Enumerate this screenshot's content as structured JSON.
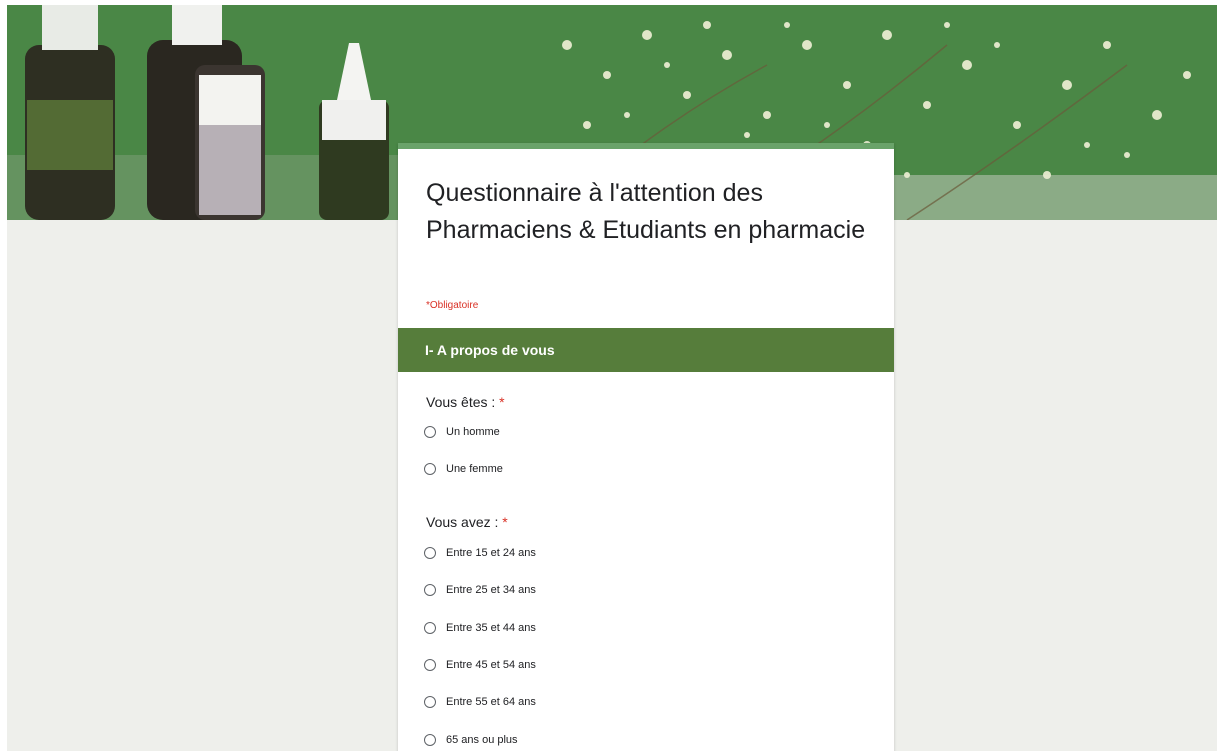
{
  "form": {
    "title": "Questionnaire à l'attention des Pharmaciens & Etudiants en pharmacie",
    "required_note": "*Obligatoire"
  },
  "section": {
    "title": "I- A propos de vous"
  },
  "questions": [
    {
      "label": "Vous êtes :",
      "required_mark": "*",
      "options": [
        "Un homme",
        "Une femme"
      ]
    },
    {
      "label": "Vous avez :",
      "required_mark": "*",
      "options": [
        "Entre 15 et 24 ans",
        "Entre 25 et 34 ans",
        "Entre 35 et 44 ans",
        "Entre 45 et 54 ans",
        "Entre 55 et 64 ans",
        "65 ans ou plus"
      ]
    }
  ],
  "colors": {
    "page_background": "#eeefeb",
    "section_header": "#567d3b",
    "card_accent": "#6aa36a",
    "required": "#d93025"
  },
  "icons": {
    "radio": "radio-unchecked-icon"
  }
}
